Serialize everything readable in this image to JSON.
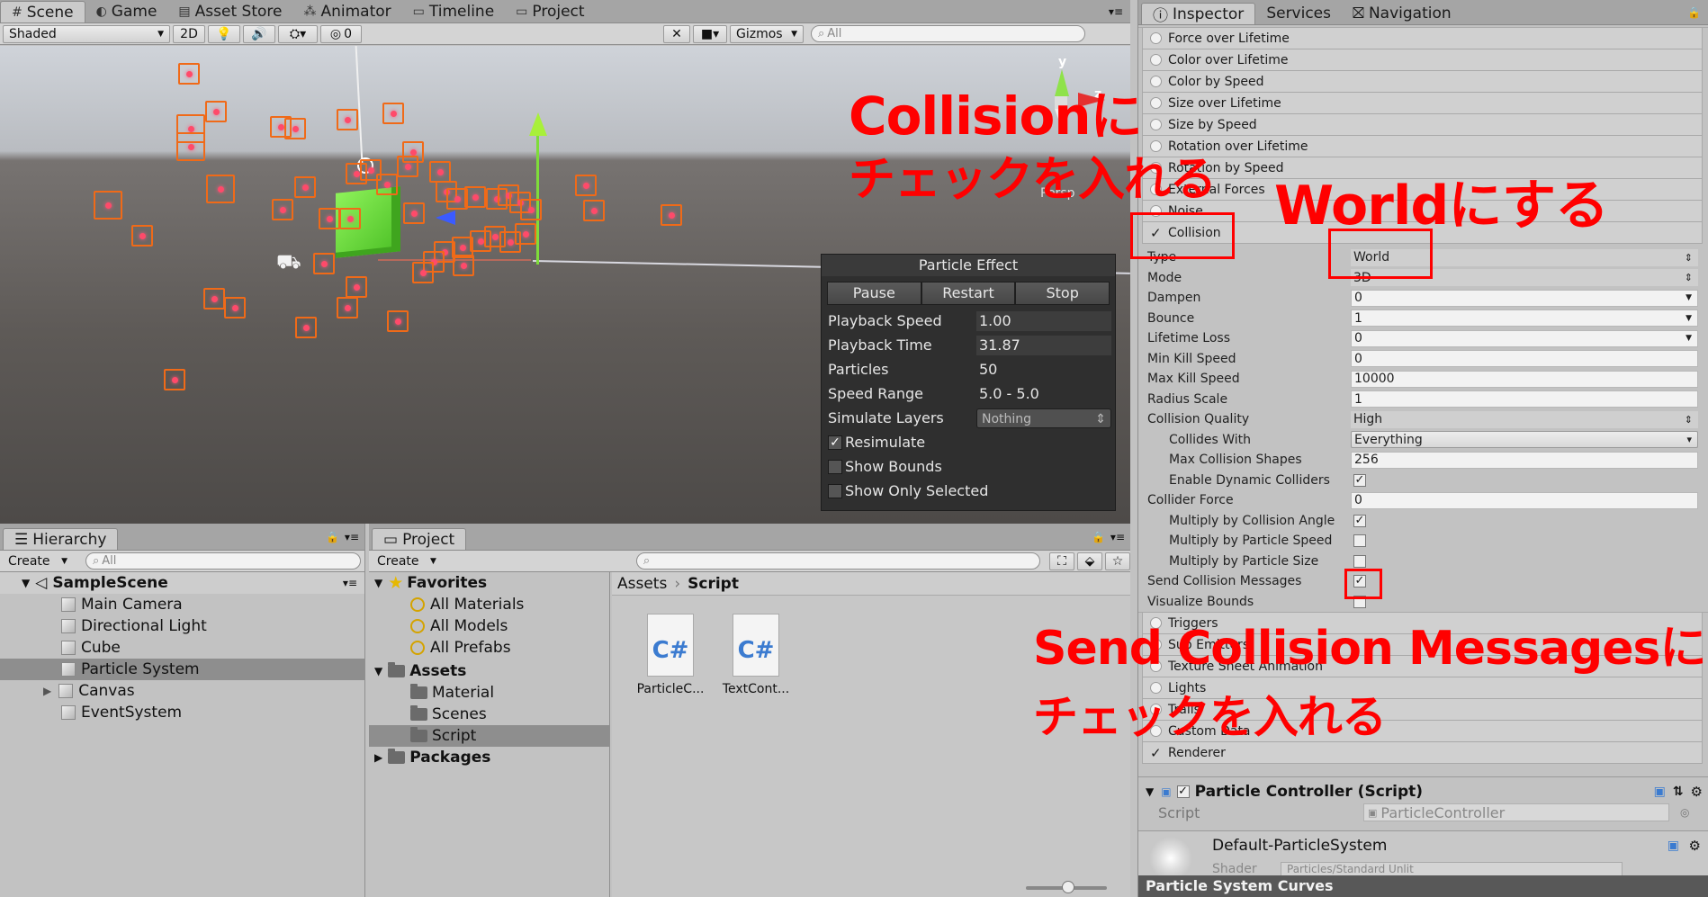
{
  "scene_tabs": [
    {
      "icon": "grid-icon",
      "glyph": "#",
      "label": "Scene"
    },
    {
      "icon": "game-icon",
      "glyph": "◐",
      "label": "Game"
    },
    {
      "icon": "store-icon",
      "glyph": "▤",
      "label": "Asset Store"
    },
    {
      "icon": "animator-icon",
      "glyph": "⁂",
      "label": "Animator"
    },
    {
      "icon": "timeline-icon",
      "glyph": "▭",
      "label": "Timeline"
    },
    {
      "icon": "folder-icon",
      "glyph": "▭",
      "label": "Project"
    }
  ],
  "scene_toolbar": {
    "shading": "Shaded",
    "mode_2d": "2D",
    "hidden_count": "0",
    "gizmos": "Gizmos",
    "search_placeholder": "All"
  },
  "axis_gizmo": {
    "y": "y",
    "z": "z",
    "persp": "Persp"
  },
  "particle_effect": {
    "title": "Particle Effect",
    "buttons": [
      "Pause",
      "Restart",
      "Stop"
    ],
    "playback_speed_label": "Playback Speed",
    "playback_speed": "1.00",
    "playback_time_label": "Playback Time",
    "playback_time": "31.87",
    "particles_label": "Particles",
    "particles": "50",
    "speed_range_label": "Speed Range",
    "speed_range": "5.0 - 5.0",
    "simulate_layers_label": "Simulate Layers",
    "simulate_layers": "Nothing",
    "resimulate": "Resimulate",
    "show_bounds": "Show Bounds",
    "show_only_selected": "Show Only Selected"
  },
  "hierarchy": {
    "tab": "Hierarchy",
    "create": "Create",
    "search_placeholder": "All",
    "scene": "SampleScene",
    "items": [
      "Main Camera",
      "Directional Light",
      "Cube",
      "Particle System",
      "Canvas",
      "EventSystem"
    ],
    "selected": "Particle System"
  },
  "project": {
    "tab": "Project",
    "create": "Create",
    "favorites": "Favorites",
    "fav_items": [
      "All Materials",
      "All Models",
      "All Prefabs"
    ],
    "assets": "Assets",
    "asset_folders": [
      "Material",
      "Scenes",
      "Script"
    ],
    "packages": "Packages",
    "breadcrumb_root": "Assets",
    "breadcrumb_leaf": "Script",
    "files": [
      {
        "badge": "C#",
        "name": "ParticleC..."
      },
      {
        "badge": "C#",
        "name": "TextCont..."
      }
    ]
  },
  "inspector": {
    "tabs": [
      "Inspector",
      "Services",
      "Navigation"
    ],
    "modules_top": [
      "Force over Lifetime",
      "Color over Lifetime",
      "Color by Speed",
      "Size over Lifetime",
      "Size by Speed",
      "Rotation over Lifetime",
      "Rotation by Speed",
      "External Forces",
      "Noise"
    ],
    "collision": "Collision",
    "props": [
      {
        "k": "Type",
        "v": "World",
        "kind": "sel",
        "ind": false
      },
      {
        "k": "Mode",
        "v": "3D",
        "kind": "sel",
        "ind": false
      },
      {
        "k": "Dampen",
        "v": "0",
        "kind": "field-arrow",
        "ind": false
      },
      {
        "k": "Bounce",
        "v": "1",
        "kind": "field-arrow",
        "ind": false
      },
      {
        "k": "Lifetime Loss",
        "v": "0",
        "kind": "field-arrow",
        "ind": false
      },
      {
        "k": "Min Kill Speed",
        "v": "0",
        "kind": "field",
        "ind": false
      },
      {
        "k": "Max Kill Speed",
        "v": "10000",
        "kind": "field",
        "ind": false
      },
      {
        "k": "Radius Scale",
        "v": "1",
        "kind": "field",
        "ind": false
      },
      {
        "k": "Collision Quality",
        "v": "High",
        "kind": "sel",
        "ind": false
      },
      {
        "k": "Collides With",
        "v": "Everything",
        "kind": "sel-box",
        "ind": true
      },
      {
        "k": "Max Collision Shapes",
        "v": "256",
        "kind": "field",
        "ind": true
      },
      {
        "k": "Enable Dynamic Colliders",
        "v": "✓",
        "kind": "check",
        "ind": true
      },
      {
        "k": "Collider Force",
        "v": "0",
        "kind": "field",
        "ind": false
      },
      {
        "k": "Multiply by Collision Angle",
        "v": "✓",
        "kind": "check",
        "ind": true
      },
      {
        "k": "Multiply by Particle Speed",
        "v": "",
        "kind": "check",
        "ind": true
      },
      {
        "k": "Multiply by Particle Size",
        "v": "",
        "kind": "check",
        "ind": true
      },
      {
        "k": "Send Collision Messages",
        "v": "✓",
        "kind": "check",
        "ind": false
      },
      {
        "k": "Visualize Bounds",
        "v": "",
        "kind": "check",
        "ind": false
      }
    ],
    "modules_bottom": [
      "Triggers",
      "Sub Emitters",
      "Texture Sheet Animation",
      "Lights",
      "Trails",
      "Custom Data"
    ],
    "renderer": "Renderer",
    "script_component": "Particle Controller (Script)",
    "script_label": "Script",
    "script_value": "ParticleController",
    "material": "Default-ParticleSystem",
    "shader_label": "Shader",
    "shader_value": "Particles/Standard Unlit",
    "curves": "Particle System Curves"
  },
  "annotations": {
    "a1_line1": "Collisionに",
    "a1_line2": "チェックを入れる",
    "a2": "Worldにする",
    "a3_line1": "Send Collision Messagesに",
    "a3_line2": "チェックを入れる"
  },
  "colors": {
    "annotation": "#ff0000",
    "particle": "#f06a18",
    "cube": "#6ee03a"
  }
}
